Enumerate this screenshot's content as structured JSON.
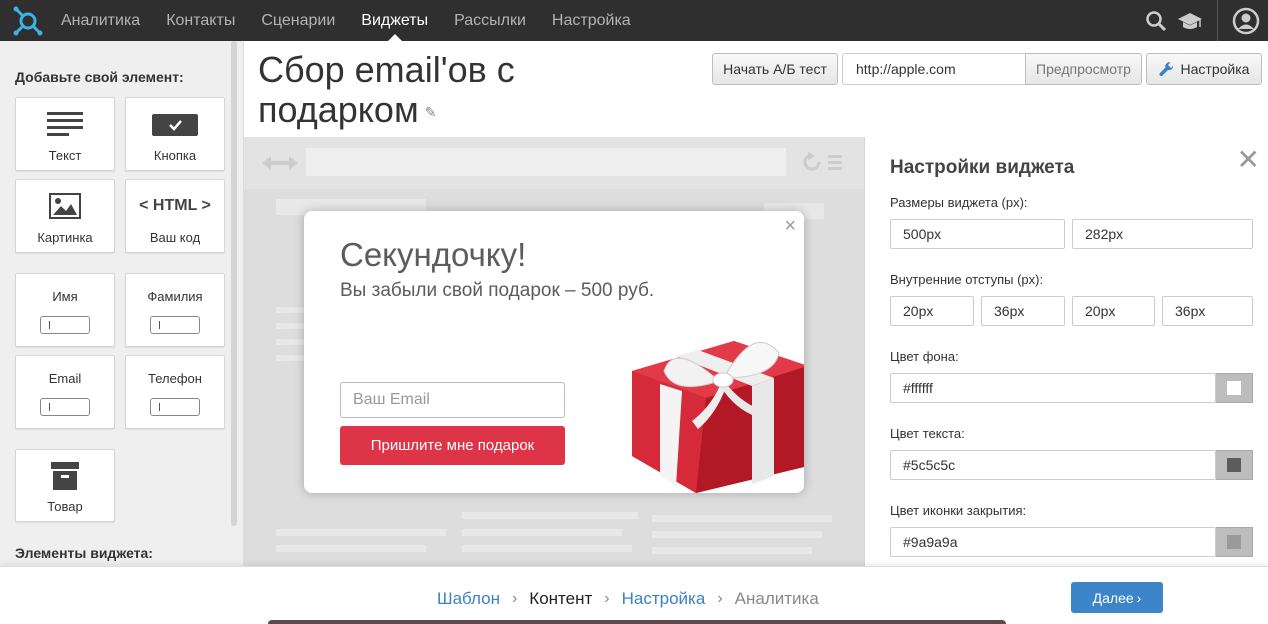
{
  "nav": {
    "items": [
      "Аналитика",
      "Контакты",
      "Сценарии",
      "Виджеты",
      "Рассылки",
      "Настройка"
    ],
    "active": "Виджеты"
  },
  "sidebar": {
    "add_title": "Добавьте свой элемент:",
    "tiles": {
      "text": "Текст",
      "button": "Кнопка",
      "image": "Картинка",
      "html": "Ваш код",
      "html_glyph": "< HTML >",
      "name": "Имя",
      "surname": "Фамилия",
      "email": "Email",
      "phone": "Телефон",
      "product": "Товар"
    },
    "elements_title": "Элементы виджета:"
  },
  "header": {
    "title": "Сбор email'ов с подарком",
    "ab_test_label": "Начать А/Б тест",
    "url_value": "http://apple.com",
    "preview_label": "Предпросмотр",
    "settings_label": "Настройка"
  },
  "popup": {
    "heading": "Секундочку!",
    "subheading": "Вы забыли свой подарок – 500 руб.",
    "email_placeholder": "Ваш Email",
    "submit_label": "Пришлите мне подарок",
    "close_glyph": "×"
  },
  "settings": {
    "title": "Настройки виджета",
    "size_label": "Размеры виджета (px):",
    "size": [
      "500px",
      "282px"
    ],
    "padding_label": "Внутренние отступы (px):",
    "padding": [
      "20px",
      "36px",
      "20px",
      "36px"
    ],
    "bg_label": "Цвет фона:",
    "bg_value": "#ffffff",
    "text_color_label": "Цвет текста:",
    "text_color_value": "#5c5c5c",
    "close_color_label": "Цвет иконки закрытия:",
    "close_color_value": "#9a9a9a"
  },
  "footer": {
    "steps": [
      "Шаблон",
      "Контент",
      "Настройка",
      "Аналитика"
    ],
    "current_step": "Контент",
    "next_label": "Далее"
  },
  "colors": {
    "nav_bg": "#2f2f2f",
    "accent_red": "#dd3547",
    "link_blue": "#3c80c6",
    "next_btn": "#3d85c9"
  }
}
